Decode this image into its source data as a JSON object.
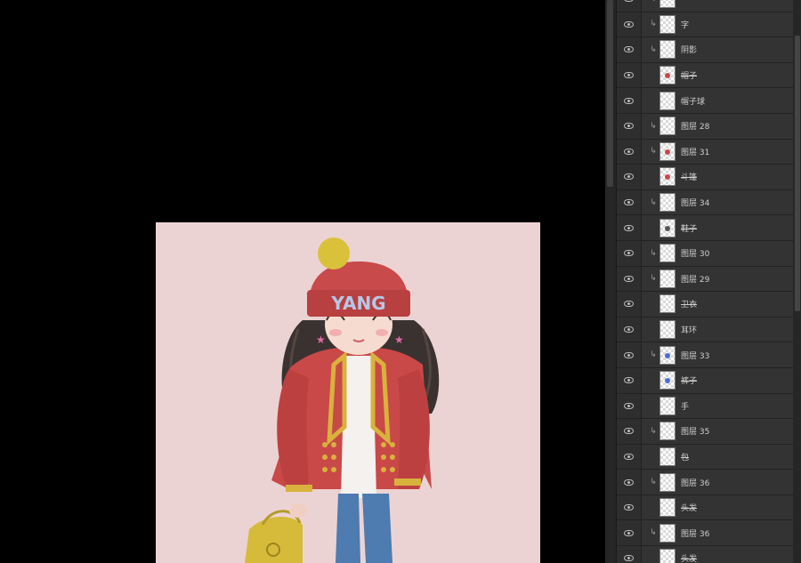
{
  "layers": [
    {
      "name": "",
      "clipped": true,
      "struck": false,
      "mark": ""
    },
    {
      "name": "字",
      "clipped": true,
      "struck": false,
      "mark": ""
    },
    {
      "name": "阴影",
      "clipped": true,
      "struck": false,
      "mark": ""
    },
    {
      "name": "帽子",
      "clipped": false,
      "struck": true,
      "mark": "#c94848"
    },
    {
      "name": "帽子球",
      "clipped": false,
      "struck": false,
      "mark": ""
    },
    {
      "name": "图层 28",
      "clipped": true,
      "struck": false,
      "mark": ""
    },
    {
      "name": "图层 31",
      "clipped": true,
      "struck": false,
      "mark": "#c94848"
    },
    {
      "name": "斗篷",
      "clipped": false,
      "struck": true,
      "mark": "#c94848"
    },
    {
      "name": "图层 34",
      "clipped": true,
      "struck": false,
      "mark": ""
    },
    {
      "name": "鞋子",
      "clipped": false,
      "struck": true,
      "mark": "#555555"
    },
    {
      "name": "图层 30",
      "clipped": true,
      "struck": false,
      "mark": ""
    },
    {
      "name": "图层 29",
      "clipped": true,
      "struck": false,
      "mark": ""
    },
    {
      "name": "卫衣",
      "clipped": false,
      "struck": true,
      "mark": ""
    },
    {
      "name": "耳环",
      "clipped": false,
      "struck": false,
      "mark": ""
    },
    {
      "name": "图层 33",
      "clipped": true,
      "struck": false,
      "mark": "#4a6fd0"
    },
    {
      "name": "裤子",
      "clipped": false,
      "struck": true,
      "mark": "#4a6fd0"
    },
    {
      "name": "手",
      "clipped": false,
      "struck": false,
      "mark": ""
    },
    {
      "name": "图层 35",
      "clipped": true,
      "struck": false,
      "mark": ""
    },
    {
      "name": "包",
      "clipped": false,
      "struck": true,
      "mark": ""
    },
    {
      "name": "图层 36",
      "clipped": true,
      "struck": false,
      "mark": ""
    },
    {
      "name": "头发",
      "clipped": false,
      "struck": true,
      "mark": ""
    },
    {
      "name": "图层 36",
      "clipped": true,
      "struck": false,
      "mark": ""
    },
    {
      "name": "头发",
      "clipped": false,
      "struck": true,
      "mark": ""
    }
  ],
  "artwork": {
    "hat_text": "YANG",
    "colors": {
      "background": "#ecd3d3",
      "hat": "#c84a4a",
      "pompom": "#d9c23a",
      "jacket": "#c94848",
      "gold": "#d8b23c",
      "jeans": "#4e7bb0",
      "hair": "#3a3230",
      "skin": "#f6dcd0",
      "bag": "#d6bb3a"
    }
  }
}
